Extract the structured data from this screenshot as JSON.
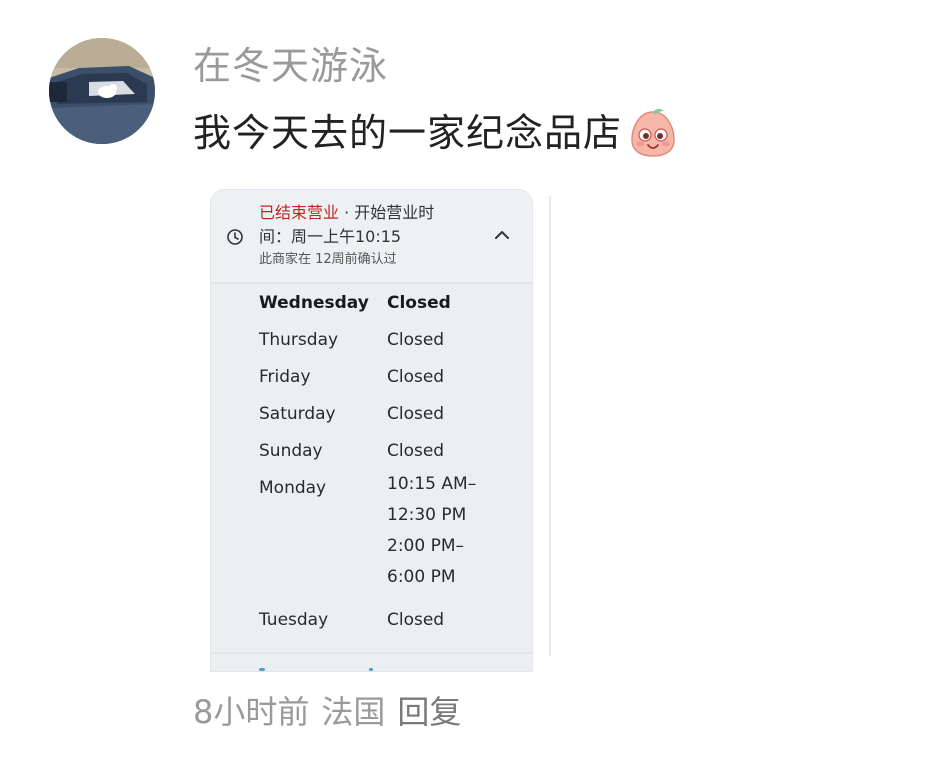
{
  "comment": {
    "username": "在冬天游泳",
    "text": "我今天去的一家纪念品店",
    "emoji": "smiling-face-emoji",
    "time": "8小时前",
    "location": "法国",
    "reply_label": "回复"
  },
  "screenshot": {
    "status_closed": "已结束营业",
    "status_sep": " · ",
    "status_open_prefix": "开始营业时",
    "status_open_suffix": "间：周一上午10:15",
    "verified": "此商家在 12周前确认过",
    "hours": [
      {
        "day": "Wednesday",
        "value": "Closed"
      },
      {
        "day": "Thursday",
        "value": "Closed"
      },
      {
        "day": "Friday",
        "value": "Closed"
      },
      {
        "day": "Saturday",
        "value": "Closed"
      },
      {
        "day": "Sunday",
        "value": "Closed"
      },
      {
        "day": "Monday",
        "line1": "10:15 AM–",
        "line2": "12:30 PM",
        "line3": "2:00 PM–",
        "line4": "6:00 PM"
      },
      {
        "day": "Tuesday",
        "value": "Closed"
      }
    ]
  },
  "colors": {
    "closed_red": "#c5221f",
    "meta_gray": "#9a9a9a",
    "text_dark": "#222222",
    "card_bg": "#eceff2"
  }
}
